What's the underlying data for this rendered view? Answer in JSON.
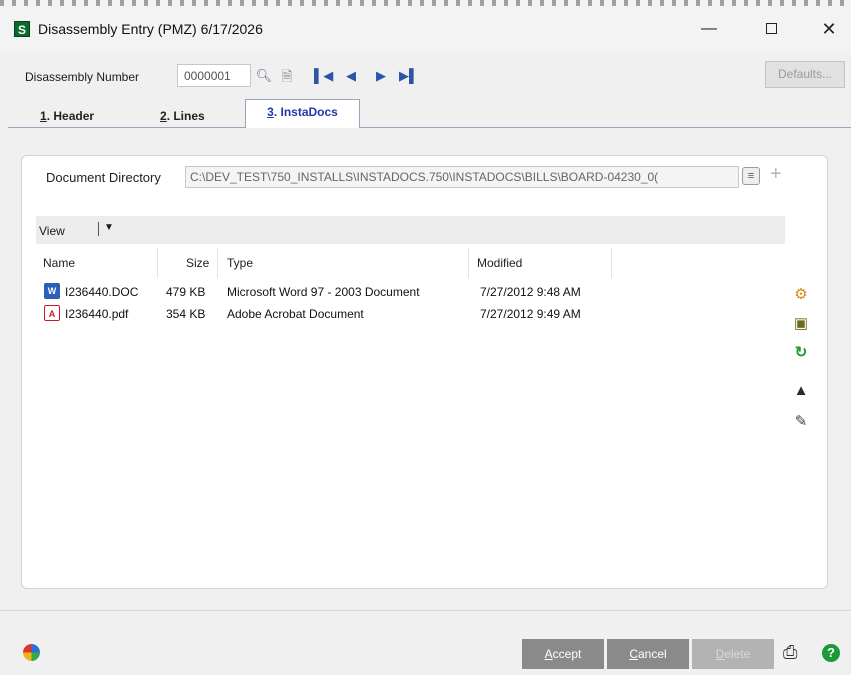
{
  "window": {
    "title": "Disassembly Entry (PMZ) 6/17/2026",
    "app_icon_letter": "S",
    "minimize_glyph": "—",
    "close_glyph": "✕"
  },
  "form": {
    "disassembly_number_label": "Disassembly Number",
    "disassembly_number_value": "0000001",
    "defaults_button": "Defaults..."
  },
  "nav_icons": [
    "search-icon",
    "lookup-icon",
    "first-record-icon",
    "previous-record-icon",
    "next-record-icon",
    "last-record-icon"
  ],
  "tabs": [
    {
      "num": "1",
      "label": ". Header"
    },
    {
      "num": "2",
      "label": ". Lines"
    },
    {
      "num": "3",
      "label": ". InstaDocs"
    }
  ],
  "instadocs": {
    "document_directory_label": "Document Directory",
    "document_directory_value": "C:\\DEV_TEST\\750_INSTALLS\\INSTADOCS.750\\INSTADOCS\\BILLS\\BOARD-04230_0(",
    "view_label": "View",
    "columns": [
      "Name",
      "Size",
      "Type",
      "Modified"
    ],
    "files": [
      {
        "name": "I236440.DOC",
        "size": "479 KB",
        "type": "Microsoft Word 97 - 2003 Document",
        "modified": "7/27/2012 9:48 AM",
        "icon": "word-document-icon"
      },
      {
        "name": "I236440.pdf",
        "size": "354 KB",
        "type": "Adobe Acrobat Document",
        "modified": "7/27/2012 9:49 AM",
        "icon": "pdf-document-icon"
      }
    ]
  },
  "buttons": {
    "accept_key": "A",
    "accept_rest": "ccept",
    "cancel_key": "C",
    "cancel_rest": "ancel",
    "delete_key": "D",
    "delete_rest": "elete"
  },
  "colors": {
    "tab_active_text": "#2337a8",
    "button_bg": "#8a8a8a",
    "app_icon_bg": "#0b6b2f"
  }
}
